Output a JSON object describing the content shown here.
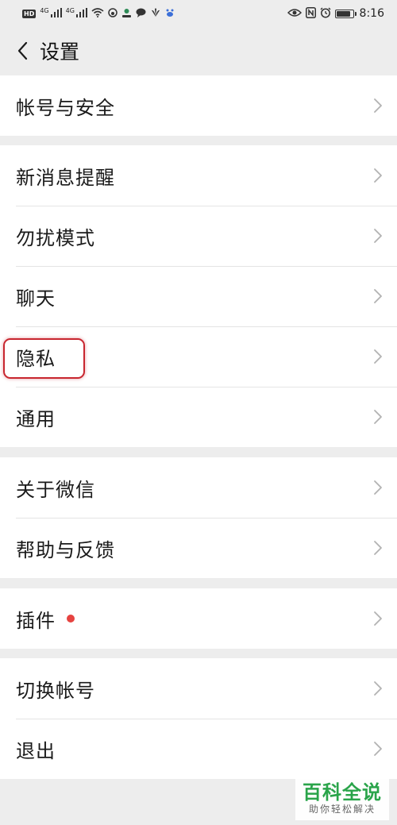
{
  "status_bar": {
    "hd_badge": "HD",
    "network_1": "4G",
    "network_2": "4G",
    "time": "8:16",
    "battery_level": 0.85
  },
  "navbar": {
    "title": "设置"
  },
  "groups": [
    {
      "items": [
        {
          "label": "帐号与安全"
        }
      ]
    },
    {
      "items": [
        {
          "label": "新消息提醒"
        },
        {
          "label": "勿扰模式"
        },
        {
          "label": "聊天"
        },
        {
          "label": "隐私",
          "highlighted": true
        },
        {
          "label": "通用"
        }
      ]
    },
    {
      "items": [
        {
          "label": "关于微信"
        },
        {
          "label": "帮助与反馈"
        }
      ]
    },
    {
      "items": [
        {
          "label": "插件",
          "badge": "red-dot"
        }
      ]
    },
    {
      "items": [
        {
          "label": "切换帐号"
        },
        {
          "label": "退出"
        }
      ]
    }
  ],
  "colors": {
    "background": "#ededed",
    "highlight": "#c8262f",
    "badge": "#e64340",
    "watermark_green": "#2aa44a"
  },
  "watermark": {
    "title": "百科全说",
    "subtitle": "助你轻松解决"
  }
}
